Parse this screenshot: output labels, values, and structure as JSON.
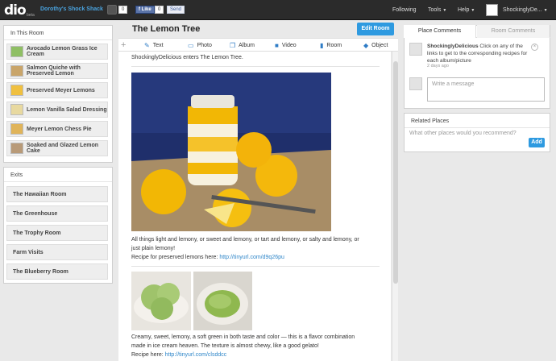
{
  "header": {
    "logo": "dio",
    "beta": "beta",
    "site_name": "Dorothy's Shock Shack",
    "like_count": "0",
    "fb_like": "Like",
    "fb_count": "0",
    "fb_send": "Send",
    "nav": {
      "following": "Following",
      "tools": "Tools",
      "help": "Help",
      "user": "ShockinglyDe..."
    }
  },
  "left": {
    "in_this_room": "In This Room",
    "rooms": [
      "Avocado Lemon Grass Ice Cream",
      "Salmon Quiche with Preserved Lemon",
      "Preserved Meyer Lemons",
      "Lemon Vanilla Salad Dressing",
      "Meyer Lemon Chess Pie",
      "Soaked and Glazed Lemon Cake"
    ],
    "exits_title": "Exits",
    "exits": [
      "The Hawaiian Room",
      "The Greenhouse",
      "The Trophy Room",
      "Farm Visits",
      "The Blueberry Room"
    ]
  },
  "main": {
    "title": "The Lemon Tree",
    "edit_button": "Edit Room",
    "toolbar": {
      "text": "Text",
      "photo": "Photo",
      "album": "Album",
      "video": "Video",
      "room": "Room",
      "object": "Object",
      "add": "+"
    },
    "feed": {
      "enter_line": "ShockinglyDelicious enters The Lemon Tree.",
      "post1_line1": "All things light and lemony, or sweet and lemony, or tart and lemony, or salty and lemony, or",
      "post1_line2": "just plain lemony!",
      "post1_recipe": "Recipe for preserved lemons here: ",
      "post1_link": "http://tinyurl.com/d9q26pu",
      "post2_line1": "Creamy, sweet, lemony, a soft green in both taste and color — this is a flavor combination",
      "post2_line2": "made in ice cream heaven. The texture is almost chewy, like a good gelato!",
      "post2_recipe": "Recipe here: ",
      "post2_link": "http://tinyurl.com/clsddcc"
    }
  },
  "right": {
    "tab_place": "Place Comments",
    "tab_room": "Room Comments",
    "comment_user": "ShockinglyDelicious",
    "comment_text": " Click on any of the links to get to the corresponding recipes for each album/picture",
    "comment_time": "2 days ago",
    "message_placeholder": "Write a message",
    "related_title": "Related Places",
    "related_question": "What other places would you recommend?",
    "add_button": "Add"
  },
  "colors": {
    "accent": "#2e9ae0",
    "topbar": "#2b2b2b",
    "link": "#2e86c9",
    "lemon": "#f2b705",
    "navy_bg": "#1f2f6b"
  }
}
